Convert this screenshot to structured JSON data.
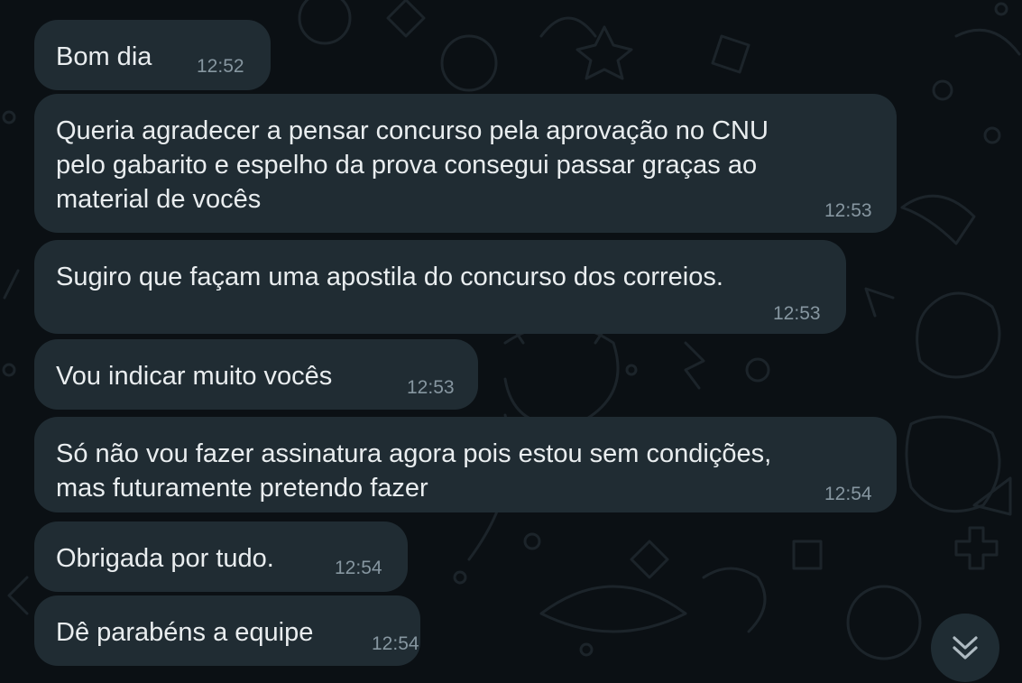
{
  "messages": [
    {
      "text": "Bom dia",
      "time": "12:52"
    },
    {
      "text": "Queria agradecer a pensar concurso pela aprovação no CNU\npelo gabarito e espelho da prova consegui passar graças ao\nmaterial de vocês",
      "time": "12:53"
    },
    {
      "text": "Sugiro que façam uma apostila do concurso dos correios.",
      "time": "12:53"
    },
    {
      "text": "Vou indicar muito vocês",
      "time": "12:53"
    },
    {
      "text": "Só não vou fazer assinatura agora pois estou sem condições,\nmas futuramente pretendo fazer",
      "time": "12:54"
    },
    {
      "text": "Obrigada por tudo.",
      "time": "12:54"
    },
    {
      "text": "Dê parabéns a equipe",
      "time": "12:54"
    }
  ],
  "scroll_button": {
    "icon": "double-chevron-down-icon"
  },
  "colors": {
    "background": "#0b1014",
    "bubble": "#202c33",
    "text": "#e9edef",
    "timestamp": "#8696a0"
  }
}
